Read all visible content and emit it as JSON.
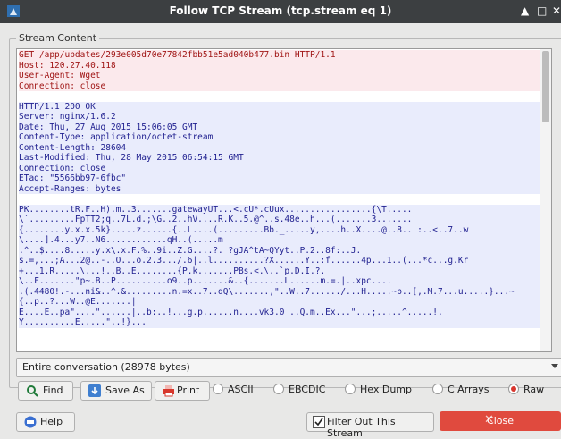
{
  "window": {
    "title": "Follow TCP Stream (tcp.stream eq 1)"
  },
  "group": {
    "label": "Stream Content"
  },
  "stream": {
    "client_request": [
      "GET /app/updates/293e005d70e77842fbb51e5ad040b477.bin HTTP/1.1",
      "Host: 120.27.40.118",
      "User-Agent: Wget",
      "Connection: close"
    ],
    "server_headers": [
      "HTTP/1.1 200 OK",
      "Server: nginx/1.6.2",
      "Date: Thu, 27 Aug 2015 15:06:05 GMT",
      "Content-Type: application/octet-stream",
      "Content-Length: 28604",
      "Last-Modified: Thu, 28 May 2015 06:54:15 GMT",
      "Connection: close",
      "ETag: \"5566bb97-6fbc\"",
      "Accept-Ranges: bytes"
    ],
    "server_body": [
      "PK........tR.F..H).m..3.......gatewayUT...<.cU*.cUux.................{\\T.....",
      "\\`.........FpTT2;q..7L.d.;\\G..2..hV....R.K..5.@^..s.48e..h...(.......3.......",
      "{........y.x.x.5k}.....z......{..L....(.........Bb._.....y,....h..X....@..8.. :..<..7..w",
      "\\....].4...y7..N6............qH..(.....m",
      ".^..$....8.....y.x\\.x.F.%..9i..Z.G....?. ?gJA^tA~QYyt..P.2..8f:..J.",
      "s.=,...;A...2@..-..O...o.2.3.../.6|..l..........?X......Y..:f......4p...1..(...*c...g.Kr",
      "+...1.R.....\\...!..B..E........{P.k.......PBs.<.\\..`p.D.I.?.",
      "\\..F.......\"p~.B..P..........o9..p.......&..{.......L......m.=.|..xpc....",
      ".(.4480!.-...ni&..^.&.........n.=x..7..dQ\\.......,\"..W..7....../...H.....~p..[,.M.7...u.....}...~",
      "{..p..?...W..@E.......|",
      "E....E..pa\"....\"......|..b:..!...g.p......n....vk3.0 ..Q.m..Ex...\"...;.....^.....!.",
      "Y..........E.....\"..!}..."
    ]
  },
  "conversation_select": {
    "value": "Entire conversation (28978 bytes)"
  },
  "buttons": {
    "find": "Find",
    "save_as": "Save As",
    "print": "Print",
    "help": "Help",
    "filter_out": "Filter Out This Stream",
    "close": "Close"
  },
  "formats": {
    "options": [
      "ASCII",
      "EBCDIC",
      "Hex Dump",
      "C Arrays",
      "Raw"
    ],
    "selected": "Raw"
  },
  "colors": {
    "titlebar": "#3c3f41",
    "client_text": "#a01515",
    "client_bg": "#fbe9ec",
    "server_text": "#1f1f8f",
    "server_bg": "#e9ecfc",
    "close_button": "#e04a3e"
  },
  "icons": {
    "app": "wireshark-fin-icon",
    "find": "magnifier-icon",
    "save_as": "save-down-arrow-icon",
    "print": "printer-icon",
    "help": "help-icon",
    "filter_checkbox": "checked-checkbox-icon",
    "close": "close-x-icon",
    "window_controls": [
      "maximize-icon",
      "restore-icon",
      "close-icon"
    ]
  }
}
